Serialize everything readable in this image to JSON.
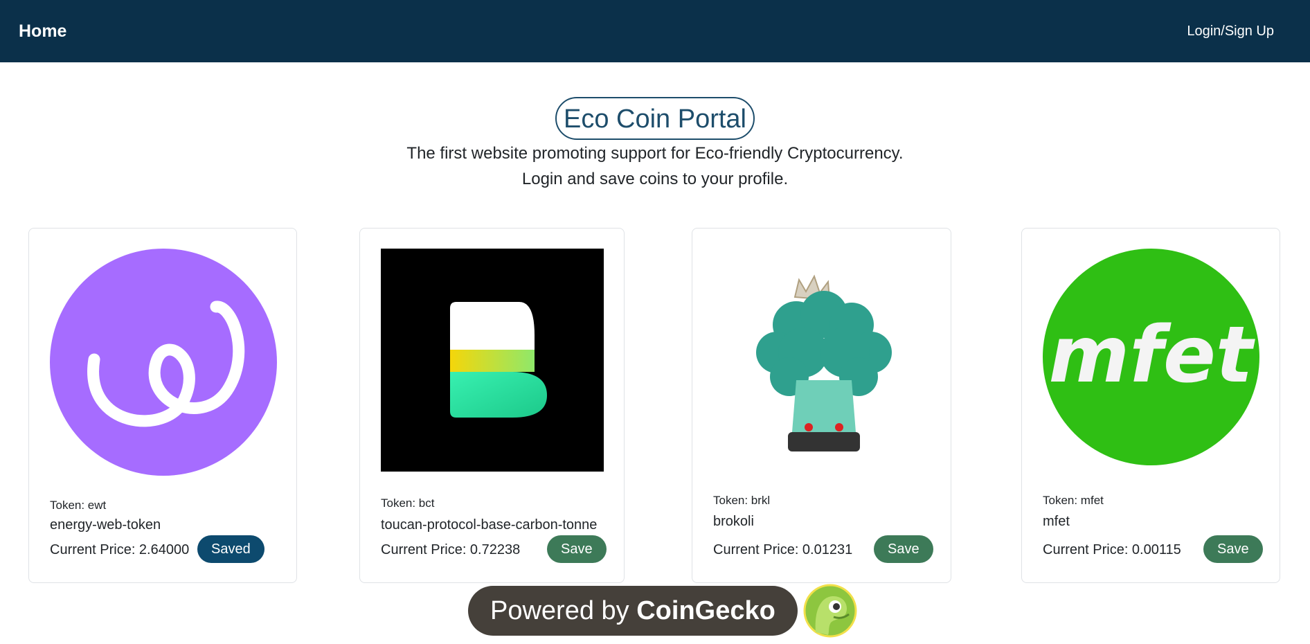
{
  "nav": {
    "brand": "Home",
    "login": "Login/Sign Up"
  },
  "hero": {
    "title": "Eco Coin Portal",
    "subtitle_line1": "The first website promoting support for Eco-friendly Cryptocurrency.",
    "subtitle_line2": "Login and save coins to your profile."
  },
  "coins": [
    {
      "token": "Token: ewt",
      "name": "energy-web-token",
      "price": "Current Price: 2.64000",
      "button": "Saved",
      "icon": "energy-web-logo",
      "color": "#a66cff"
    },
    {
      "token": "Token: bct",
      "name": "toucan-protocol-base-carbon-tonne",
      "price": "Current Price: 0.72238",
      "button": "Save",
      "icon": "toucan-b-logo",
      "color": "#000000"
    },
    {
      "token": "Token: brkl",
      "name": "brokoli",
      "price": "Current Price: 0.01231",
      "button": "Save",
      "icon": "brokoli-mascot",
      "color": "#3fae9a"
    },
    {
      "token": "Token: mfet",
      "name": "mfet",
      "price": "Current Price: 0.00115",
      "button": "Save",
      "icon": "mfet-logo",
      "color": "#2fbf14"
    }
  ],
  "footer": {
    "prefix": "Powered by ",
    "brand": "CoinGecko",
    "icon": "coingecko-gecko-logo"
  }
}
